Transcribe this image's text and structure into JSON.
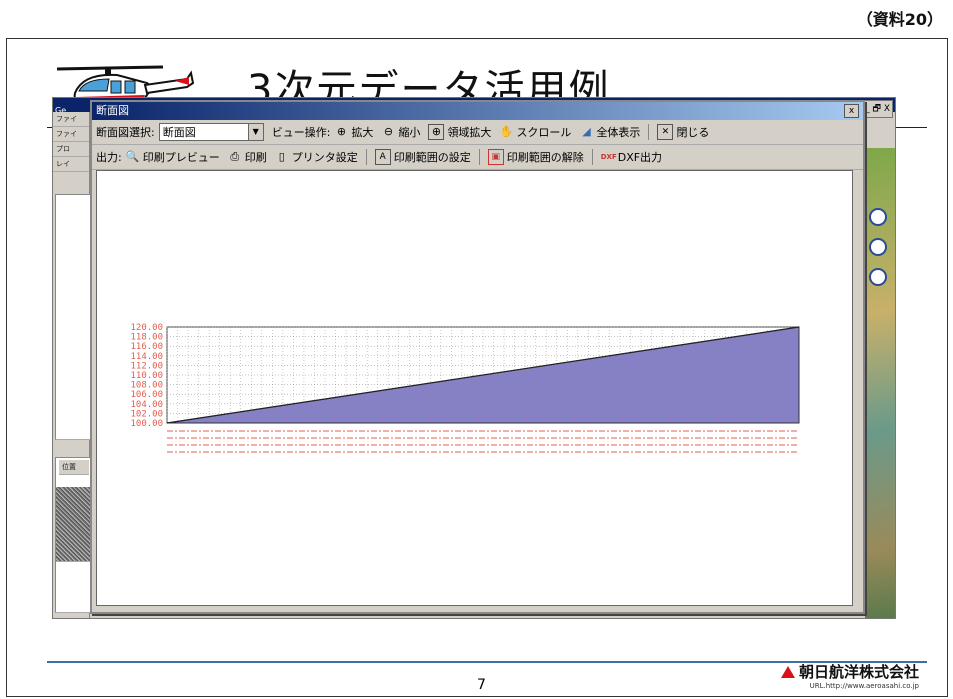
{
  "doc_label": "（資料20）",
  "slide": {
    "title": "3次元データ活用例",
    "page_number": "7",
    "company": "朝日航洋株式会社",
    "url": "URL.http://www.aeroasahi.co.jp"
  },
  "bg_app": {
    "title_fragment": "Ge",
    "left_items": [
      "ファイ",
      "ファイ",
      "プロ",
      "レイ"
    ],
    "lower_label": "位置",
    "controls": "_ 🗗 X"
  },
  "dialog": {
    "title": "断面図",
    "close_label": "x",
    "toolbar1": {
      "select_label": "断面図選択:",
      "select_value": "断面図",
      "view_label": "ビュー操作:",
      "zoom_in": "拡大",
      "zoom_out": "縮小",
      "area_zoom": "領域拡大",
      "scroll": "スクロール",
      "fit_all": "全体表示",
      "close": "閉じる"
    },
    "toolbar2": {
      "output_label": "出力:",
      "preview": "印刷プレビュー",
      "print": "印刷",
      "printer_setup": "プリンタ設定",
      "set_range": "印刷範囲の設定",
      "clear_range": "印刷範囲の解除",
      "dxf": "DXF出力"
    }
  },
  "chart_data": {
    "type": "area",
    "y_ticks": [
      "120.00",
      "118.00",
      "116.00",
      "114.00",
      "112.00",
      "110.00",
      "108.00",
      "106.00",
      "104.00",
      "102.00",
      "100.00"
    ],
    "ylim": [
      100,
      120
    ],
    "x": [
      0,
      1
    ],
    "values": [
      100,
      120
    ],
    "colors": {
      "fill": "#8680c4",
      "label": "#e06050",
      "grid": "#444444"
    }
  }
}
